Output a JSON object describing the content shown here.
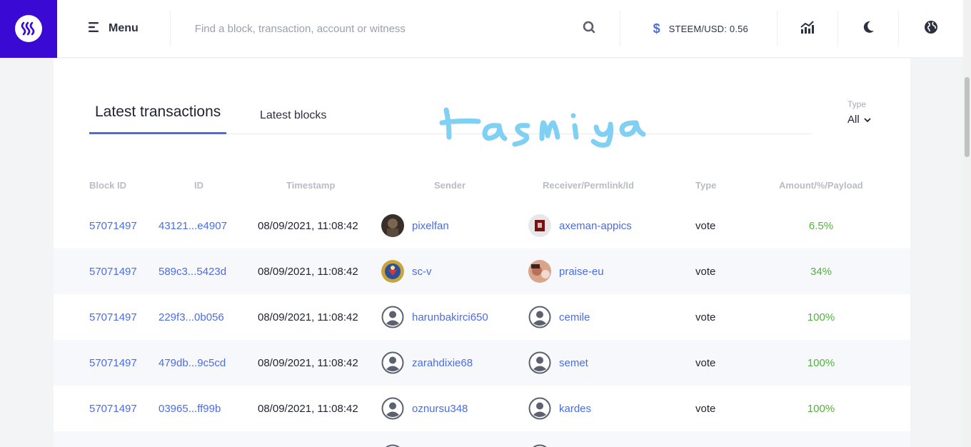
{
  "header": {
    "menu_label": "Menu",
    "search_placeholder": "Find a block, transaction, account or witness",
    "price_label": "STEEM/USD: 0.56"
  },
  "tabs": {
    "active": "Latest transactions",
    "inactive": "Latest blocks"
  },
  "type_filter": {
    "label": "Type",
    "value": "All"
  },
  "columns": [
    "Block ID",
    "ID",
    "Timestamp",
    "Sender",
    "Receiver/Permlink/Id",
    "Type",
    "Amount/%/Payload"
  ],
  "rows": [
    {
      "block_id": "57071497",
      "id": "43121...e4907",
      "timestamp": "08/09/2021, 11:08:42",
      "sender": "pixelfan",
      "sender_avatar": "photo",
      "receiver": "axeman-appics",
      "receiver_avatar": "photo",
      "type": "vote",
      "amount": "6.5%"
    },
    {
      "block_id": "57071497",
      "id": "589c3...5423d",
      "timestamp": "08/09/2021, 11:08:42",
      "sender": "sc-v",
      "sender_avatar": "photo",
      "receiver": "praise-eu",
      "receiver_avatar": "photo",
      "type": "vote",
      "amount": "34%"
    },
    {
      "block_id": "57071497",
      "id": "229f3...0b056",
      "timestamp": "08/09/2021, 11:08:42",
      "sender": "harunbakirci650",
      "sender_avatar": "default",
      "receiver": "cemile",
      "receiver_avatar": "default",
      "type": "vote",
      "amount": "100%"
    },
    {
      "block_id": "57071497",
      "id": "479db...9c5cd",
      "timestamp": "08/09/2021, 11:08:42",
      "sender": "zarahdixie68",
      "sender_avatar": "default",
      "receiver": "semet",
      "receiver_avatar": "default",
      "type": "vote",
      "amount": "100%"
    },
    {
      "block_id": "57071497",
      "id": "03965...ff99b",
      "timestamp": "08/09/2021, 11:08:42",
      "sender": "oznursu348",
      "sender_avatar": "default",
      "receiver": "kardes",
      "receiver_avatar": "default",
      "type": "vote",
      "amount": "100%"
    }
  ],
  "colors": {
    "brand": "#3a0ad4",
    "link": "#4a6de5",
    "amount": "#55b042",
    "alt_row": "#f7f8fb"
  },
  "icons": [
    "steem-logo-icon",
    "menu-icon",
    "search-icon",
    "dollar-icon",
    "chart-icon",
    "moon-icon",
    "globe-icon",
    "chevron-down-icon",
    "user-default-icon"
  ]
}
